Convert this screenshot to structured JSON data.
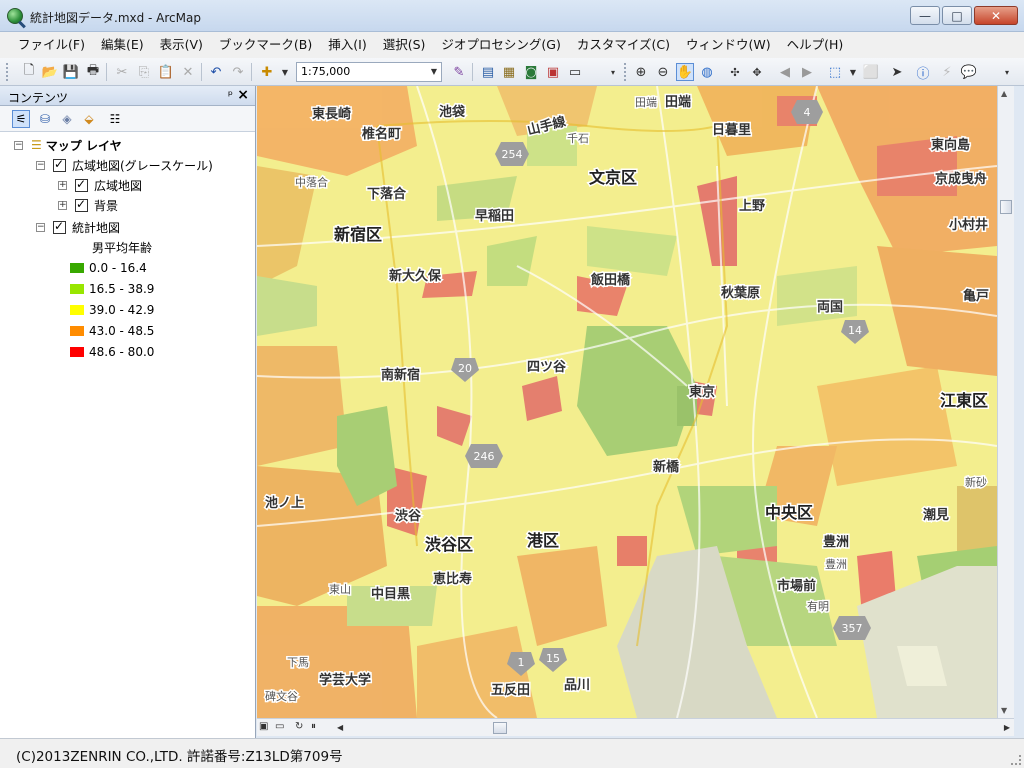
{
  "window": {
    "title": "統計地図データ.mxd - ArcMap",
    "minimize": "—",
    "maximize": "□",
    "close": "✕"
  },
  "menu": [
    "ファイル(F)",
    "編集(E)",
    "表示(V)",
    "ブックマーク(B)",
    "挿入(I)",
    "選択(S)",
    "ジオプロセシング(G)",
    "カスタマイズ(C)",
    "ウィンドウ(W)",
    "ヘルプ(H)"
  ],
  "toolbar": {
    "scale": "1:75,000"
  },
  "toc": {
    "title": "コンテンツ",
    "pin": "ᵖ",
    "close": "×",
    "tree": {
      "root": "マップ レイヤ",
      "group": "広域地図(グレースケール)",
      "group_children": [
        "広域地図",
        "背景"
      ],
      "stat_layer": "統計地図",
      "field": "男平均年齢",
      "classes": [
        {
          "label": "0.0 - 16.4",
          "color": "#38a800"
        },
        {
          "label": "16.5 - 38.9",
          "color": "#98e600"
        },
        {
          "label": "39.0 - 42.9",
          "color": "#ffff00"
        },
        {
          "label": "43.0 - 48.5",
          "color": "#ff8c00"
        },
        {
          "label": "48.6 - 80.0",
          "color": "#ff0000"
        }
      ]
    }
  },
  "map": {
    "ward_labels": [
      "新宿区",
      "文京区",
      "渋谷区",
      "港区",
      "中央区",
      "江東区"
    ],
    "place_labels": [
      "東長崎",
      "池袋",
      "山手線",
      "田端",
      "椎名町",
      "千石",
      "日暮里",
      "東向島",
      "中落合",
      "下落合",
      "上野",
      "京成曳舟",
      "早稲田",
      "小村井",
      "新大久保",
      "飯田橋",
      "秋葉原",
      "亀戸",
      "両国",
      "四ツ谷",
      "南新宿",
      "東京",
      "新橋",
      "池ノ上",
      "渋谷",
      "潮見",
      "豊洲",
      "市場前",
      "有明",
      "東山",
      "中目黒",
      "恵比寿",
      "下馬",
      "学芸大学",
      "碑文谷",
      "五反田",
      "品川",
      "新砂",
      "豊洲",
      "田端"
    ],
    "route_numbers": [
      "4",
      "254",
      "14",
      "20",
      "246",
      "357",
      "1",
      "15"
    ]
  },
  "status": {
    "copyright": "(C)2013ZENRIN CO.,LTD. 許諾番号:Z13LD第709号"
  }
}
